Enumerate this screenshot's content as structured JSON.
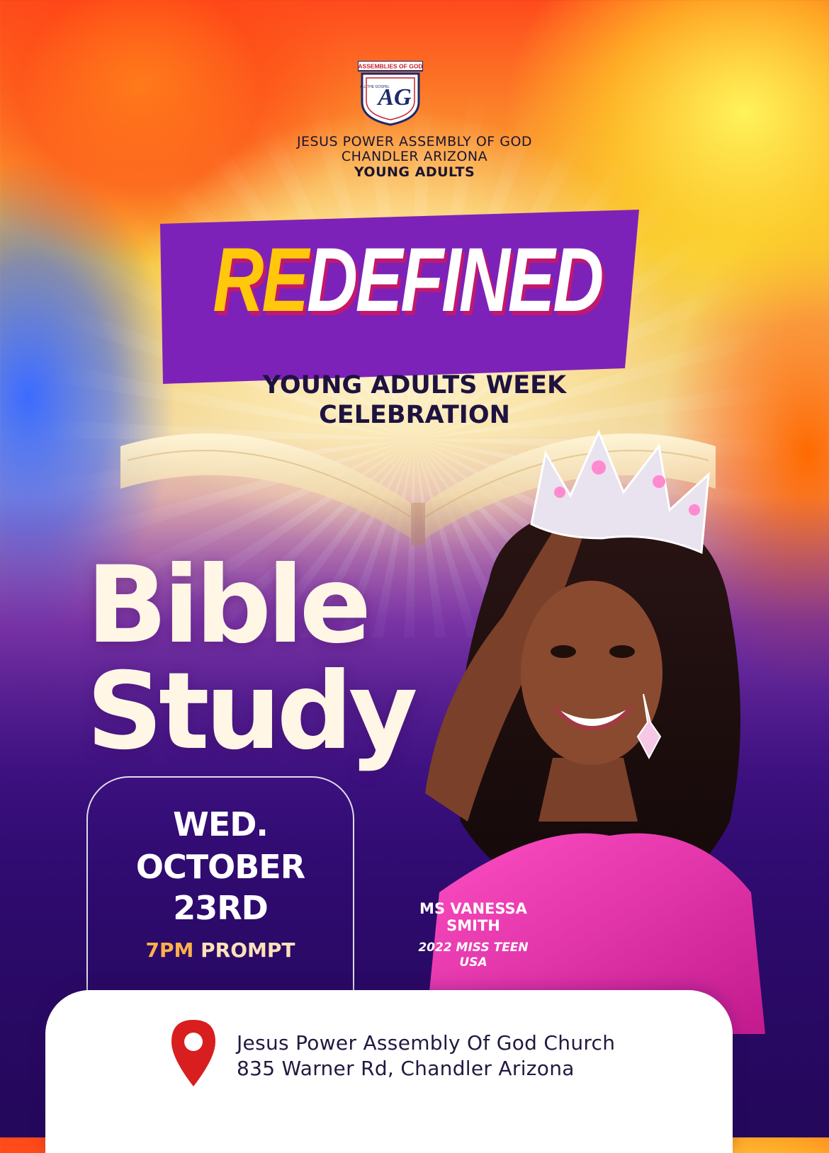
{
  "logo": {
    "top_text": "ASSEMBLIES OF GOD",
    "side_text": "ALL THE GOSPEL",
    "monogram": "AG"
  },
  "organization": {
    "line1": "JESUS POWER ASSEMBLY OF GOD",
    "line2": "CHANDLER ARIZONA",
    "line3": "YOUNG ADULTS"
  },
  "banner": {
    "title_prefix": "RE",
    "title_rest": "DEFINED",
    "subtitle_line1": "YOUNG ADULTS WEEK",
    "subtitle_line2": "CELEBRATION"
  },
  "event": {
    "title_line1": "Bible",
    "title_line2": "Study",
    "day": "WED.",
    "month": "OCTOBER",
    "date": "23RD",
    "time": "7PM",
    "time_note": "PROMPT"
  },
  "speaker": {
    "name_line1": "MS VANESSA",
    "name_line2": "SMITH",
    "title_line1": "2022 MISS TEEN",
    "title_line2": "USA"
  },
  "location": {
    "name": "Jesus Power Assembly Of God Church",
    "address": "835 Warner Rd, Chandler Arizona",
    "icon": "map-pin-icon"
  },
  "colors": {
    "banner_purple": "#7d22b8",
    "accent_yellow": "#ffc80a",
    "accent_pink": "#c2186c",
    "dark_purple": "#2a0960",
    "pin_red": "#d81e1e"
  }
}
